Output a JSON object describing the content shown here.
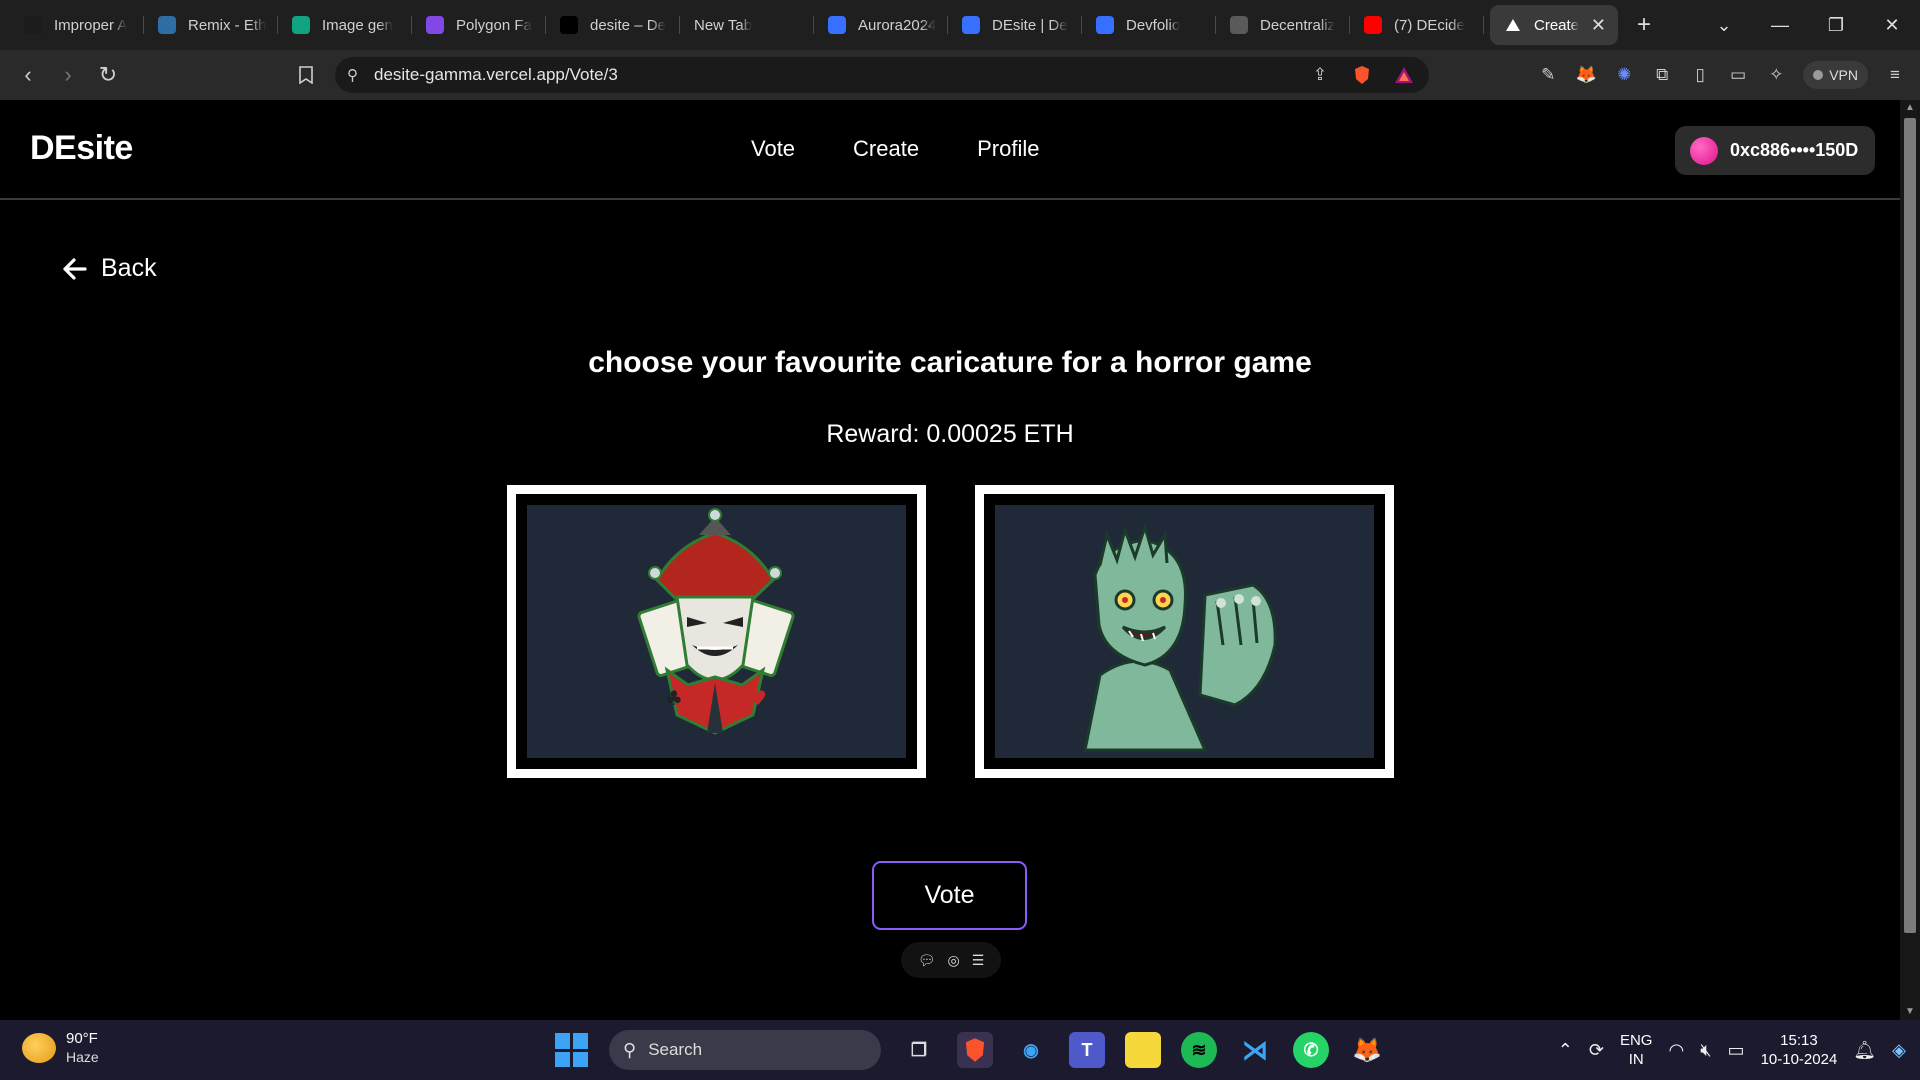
{
  "browser": {
    "tabs": [
      {
        "title": "Improper A",
        "icon": "hackmd-icon",
        "color": "#1c1c1c"
      },
      {
        "title": "Remix - Eth",
        "icon": "remix-icon",
        "color": "#2f6ea5"
      },
      {
        "title": "Image gen",
        "icon": "chatgpt-icon",
        "color": "#10a37f"
      },
      {
        "title": "Polygon Fa",
        "icon": "polygon-icon",
        "color": "#8247e5"
      },
      {
        "title": "desite – De",
        "icon": "vercel-icon",
        "color": "#000000"
      },
      {
        "title": "New Tab",
        "icon": "",
        "color": ""
      },
      {
        "title": "Aurora2024",
        "icon": "devfolio-icon",
        "color": "#3770ff"
      },
      {
        "title": "DEsite | De",
        "icon": "devfolio-icon",
        "color": "#3770ff"
      },
      {
        "title": "Devfolio",
        "icon": "devfolio-icon",
        "color": "#3770ff"
      },
      {
        "title": "Decentraliz",
        "icon": "chatgpt-icon",
        "color": "#5a5a5a"
      },
      {
        "title": "(7) DEcide",
        "icon": "youtube-icon",
        "color": "#ff0000"
      }
    ],
    "active_tab": {
      "title": "Create",
      "icon": "vercel-icon"
    },
    "url": "desite-gamma.vercel.app/Vote/3",
    "vpn_label": "VPN"
  },
  "site": {
    "logo": "DEsite",
    "nav": [
      "Vote",
      "Create",
      "Profile"
    ],
    "wallet_address": "0xc886••••150D"
  },
  "page": {
    "back_label": "Back",
    "title": "choose your favourite caricature for a horror game",
    "reward": "Reward: 0.00025 ETH",
    "options": [
      {
        "name": "joker-jester-caricature"
      },
      {
        "name": "zombie-caricature"
      }
    ],
    "vote_button": "Vote"
  },
  "taskbar": {
    "temperature": "90°F",
    "condition": "Haze",
    "search_placeholder": "Search",
    "lang_line1": "ENG",
    "lang_line2": "IN",
    "time": "15:13",
    "date": "10-10-2024"
  },
  "colors": {
    "accent": "#8b5cf6",
    "card_bg": "#1f2937",
    "wallet_avatar": "#e0118e"
  }
}
